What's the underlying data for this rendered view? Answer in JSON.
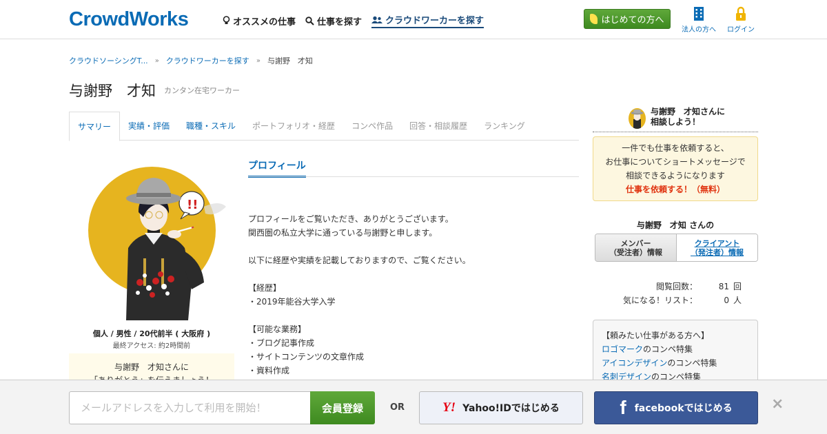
{
  "header": {
    "logo": "CrowdWorks",
    "nav": [
      {
        "label": "オススメの仕事",
        "icon": "lightbulb-icon"
      },
      {
        "label": "仕事を探す",
        "icon": "search-icon"
      },
      {
        "label": "クラウドワーカーを探す",
        "icon": "users-icon"
      }
    ],
    "start_button": "はじめての方へ",
    "corporate_label": "法人の方へ",
    "login_label": "ログイン"
  },
  "breadcrumb": {
    "items": [
      "クラウドソーシングT...",
      "クラウドワーカーを探す"
    ],
    "separator": "»",
    "current": "与謝野　才知"
  },
  "profile": {
    "name": "与謝野　才知",
    "subtitle": "カンタン在宅ワーカー",
    "info_line": "個人 / 男性 / 20代前半 ( 大阪府 )",
    "last_access": "最終アクセス: 約2時間前",
    "thanks_line1": "与謝野　才知さんに",
    "thanks_line2": "「ありがとう」を伝えましょう！"
  },
  "tabs": [
    {
      "label": "サマリー"
    },
    {
      "label": "実績・評価"
    },
    {
      "label": "職種・スキル"
    },
    {
      "label": "ポートフォリオ・経歴"
    },
    {
      "label": "コンペ作品"
    },
    {
      "label": "回答・相談履歴"
    },
    {
      "label": "ランキング"
    }
  ],
  "main": {
    "section_title": "プロフィール",
    "lines": [
      "プロフィールをご覧いただき、ありがとうございます。",
      "関西圏の私立大学に通っている与謝野と申します。",
      "",
      "以下に経歴や実績を記載しておりますので、ご覧ください。",
      "",
      "【経歴】",
      "・2019年能谷大学入学",
      "",
      "【可能な業務】",
      "・ブログ記事作成",
      "・サイトコンテンツの文章作成",
      "・資料作成"
    ]
  },
  "sidebar": {
    "consult_line1": "与謝野　才知さんに",
    "consult_line2": "相談しよう！",
    "request_line1": "一件でも仕事を依頼すると、",
    "request_line2": "お仕事についてショートメッセージで",
    "request_line3": "相談できるようになります",
    "request_cta": "仕事を依頼する！（無料）",
    "member_name": "与謝野　才知 さんの",
    "info_tab_member": "メンバー（受注者）情報",
    "info_tab_member_l1": "メンバー",
    "info_tab_member_l2": "（受注者）情報",
    "info_tab_client_l1": "クライアント",
    "info_tab_client_l2": "（発注者）情報",
    "stats": [
      {
        "label": "閲覧回数：",
        "value": "81",
        "unit": "回"
      },
      {
        "label": "気になる！リスト：",
        "value": "0",
        "unit": "人"
      }
    ],
    "feature_title": "【頼みたい仕事がある方へ】",
    "features": [
      {
        "link": "ロゴマーク",
        "suffix": "のコンペ特集"
      },
      {
        "link": "アイコンデザイン",
        "suffix": "のコンペ特集"
      },
      {
        "link": "名刺デザイン",
        "suffix": "のコンペ特集"
      }
    ]
  },
  "signup_bar": {
    "email_placeholder": "メールアドレスを入力して利用を開始！",
    "register_label": "会員登録",
    "or_label": "OR",
    "yahoo_logo": "Y!",
    "yahoo_label": "Yahoo!IDではじめる",
    "fb_logo": "f",
    "fb_label": "facebookではじめる",
    "close_label": "×"
  },
  "colors": {
    "brand_blue": "#0a6bb5",
    "green": "#4a9a2a",
    "avatar_yellow": "#e6b41f",
    "cta_red": "#e0330f",
    "facebook": "#3b5998"
  }
}
